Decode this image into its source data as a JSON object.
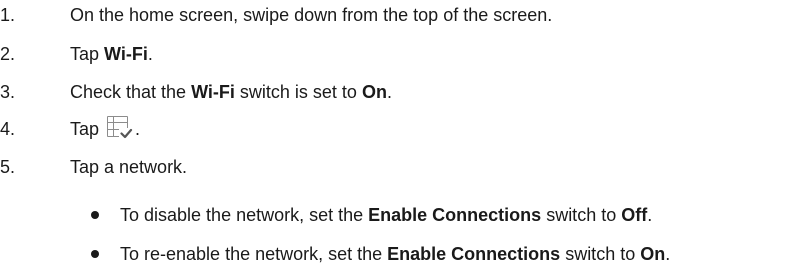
{
  "steps": [
    {
      "number": "1.",
      "text": "On the home screen, swipe down from the top of the screen."
    },
    {
      "number": "2.",
      "pre": "Tap ",
      "bold": "Wi-Fi",
      "post": "."
    },
    {
      "number": "3.",
      "pre": "Check that the ",
      "bold": "Wi-Fi",
      "mid": " switch is set to ",
      "bold2": "On",
      "post": "."
    },
    {
      "number": "4.",
      "pre": "Tap ",
      "icon": "network-list-check-icon",
      "post": "."
    },
    {
      "number": "5.",
      "text": "Tap a network."
    }
  ],
  "bullets": [
    {
      "pre": "To disable the network, set the ",
      "bold": "Enable Connections",
      "mid": " switch to ",
      "bold2": "Off",
      "post": "."
    },
    {
      "pre": "To re-enable the network, set the ",
      "bold": "Enable Connections",
      "mid": " switch to ",
      "bold2": "On",
      "post": "."
    }
  ]
}
